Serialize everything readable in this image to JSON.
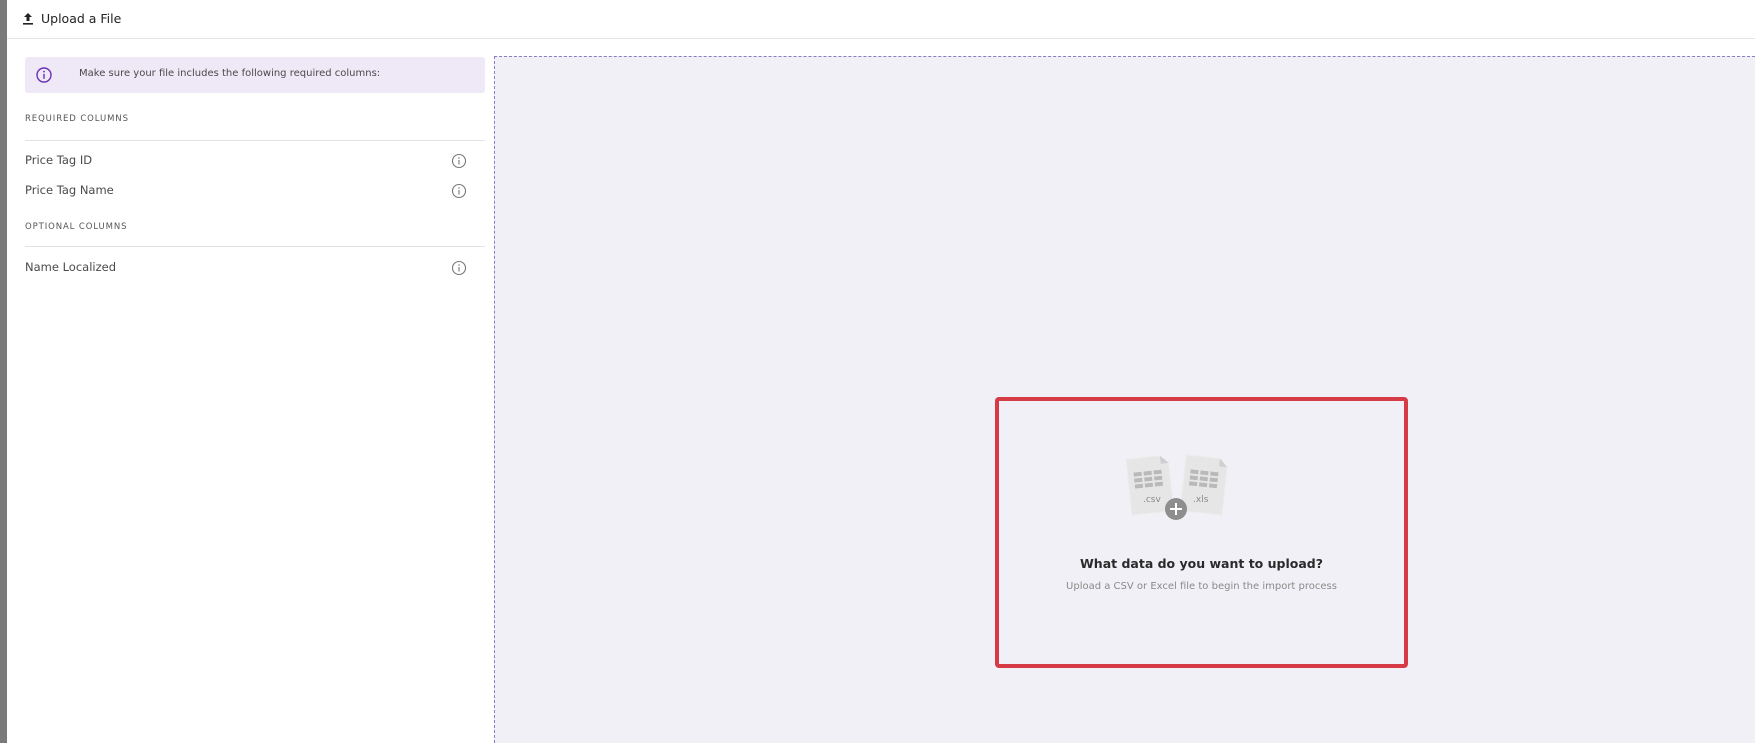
{
  "header": {
    "title": "Upload a File",
    "icon": "upload-icon"
  },
  "notice": {
    "icon": "info-icon",
    "text": "Make sure your file includes the following required columns:",
    "accent_color": "#6b2fb8"
  },
  "required_columns": {
    "heading": "REQUIRED COLUMNS",
    "items": [
      {
        "label": "Price Tag ID",
        "icon": "info-icon"
      },
      {
        "label": "Price Tag Name",
        "icon": "info-icon"
      }
    ]
  },
  "optional_columns": {
    "heading": "OPTIONAL COLUMNS",
    "items": [
      {
        "label": "Name Localized",
        "icon": "info-icon"
      }
    ]
  },
  "dropzone": {
    "file_types": [
      ".csv",
      ".xls"
    ],
    "title": "What data do you want to upload?",
    "subtitle": "Upload a CSV or Excel file to begin the import process",
    "highlight_color": "#d63a45"
  }
}
